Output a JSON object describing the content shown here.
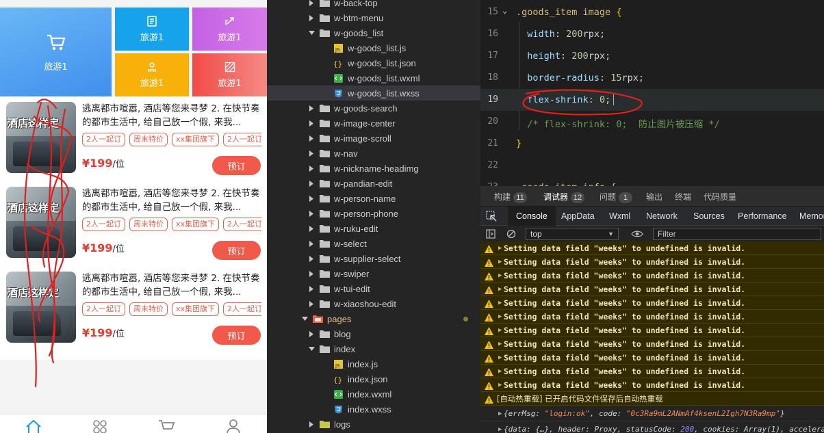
{
  "phone": {
    "tiles": [
      {
        "label": "旅游1",
        "icon": "cart-icon",
        "color": "#3f9df0"
      },
      {
        "label": "旅游1",
        "icon": "list-icon",
        "color": "#16a3ec"
      },
      {
        "label": "旅游1",
        "icon": "share-icon",
        "color": "#c461e6"
      },
      {
        "label": "旅游1",
        "icon": "user-icon",
        "color": "#f7b10a"
      },
      {
        "label": "旅游1",
        "icon": "stripes-icon",
        "color": "#f35f59"
      }
    ],
    "items": [
      {
        "title": "逃离都市喧嚣, 酒店等您来寻梦 2. 在快节奏的都市生活中, 给自己放一个假, 来我...",
        "thumb_text": "酒店这样定",
        "tags": [
          "2人一起订",
          "周末特价",
          "xx集团旗下",
          "2人一起订"
        ],
        "price": "¥199",
        "unit": "/位",
        "button": "预订"
      },
      {
        "title": "逃离都市喧嚣, 酒店等您来寻梦 2. 在快节奏的都市生活中, 给自己放一个假, 来我...",
        "thumb_text": "酒店这样定",
        "tags": [
          "2人一起订",
          "周末特价",
          "xx集团旗下",
          "2人一起订"
        ],
        "price": "¥199",
        "unit": "/位",
        "button": "预订"
      },
      {
        "title": "逃离都市喧嚣, 酒店等您来寻梦 2. 在快节奏的都市生活中, 给自己放一个假, 来我...",
        "thumb_text": "酒店这样定",
        "tags": [
          "2人一起订",
          "周末特价",
          "xx集团旗下",
          "2人一起订"
        ],
        "price": "¥199",
        "unit": "/位",
        "button": "预订"
      }
    ],
    "tabbar": [
      "home-icon",
      "apps-icon",
      "cart-icon",
      "profile-icon"
    ]
  },
  "tree": [
    {
      "name": "w-back-top",
      "type": "folder",
      "level": 1,
      "open": false
    },
    {
      "name": "w-btm-menu",
      "type": "folder",
      "level": 1,
      "open": false
    },
    {
      "name": "w-goods_list",
      "type": "folder",
      "level": 1,
      "open": true
    },
    {
      "name": "w-goods_list.js",
      "type": "js",
      "level": 2
    },
    {
      "name": "w-goods_list.json",
      "type": "json",
      "level": 2
    },
    {
      "name": "w-goods_list.wxml",
      "type": "wxml",
      "level": 2
    },
    {
      "name": "w-goods_list.wxss",
      "type": "wxss",
      "level": 2,
      "selected": true
    },
    {
      "name": "w-goods-search",
      "type": "folder",
      "level": 1,
      "open": false
    },
    {
      "name": "w-image-center",
      "type": "folder",
      "level": 1,
      "open": false
    },
    {
      "name": "w-image-scroll",
      "type": "folder",
      "level": 1,
      "open": false
    },
    {
      "name": "w-nav",
      "type": "folder",
      "level": 1,
      "open": false
    },
    {
      "name": "w-nickname-headimg",
      "type": "folder",
      "level": 1,
      "open": false
    },
    {
      "name": "w-pandian-edit",
      "type": "folder",
      "level": 1,
      "open": false
    },
    {
      "name": "w-person-name",
      "type": "folder",
      "level": 1,
      "open": false
    },
    {
      "name": "w-person-phone",
      "type": "folder",
      "level": 1,
      "open": false
    },
    {
      "name": "w-ruku-edit",
      "type": "folder",
      "level": 1,
      "open": false
    },
    {
      "name": "w-select",
      "type": "folder",
      "level": 1,
      "open": false
    },
    {
      "name": "w-supplier-select",
      "type": "folder",
      "level": 1,
      "open": false
    },
    {
      "name": "w-swiper",
      "type": "folder",
      "level": 1,
      "open": false
    },
    {
      "name": "w-tui-edit",
      "type": "folder",
      "level": 1,
      "open": false
    },
    {
      "name": "w-xiaoshou-edit",
      "type": "folder",
      "level": 1,
      "open": false
    },
    {
      "name": "pages",
      "type": "pages",
      "level": 0,
      "open": true
    },
    {
      "name": "blog",
      "type": "folder",
      "level": 1,
      "open": false
    },
    {
      "name": "index",
      "type": "folder",
      "level": 1,
      "open": true
    },
    {
      "name": "index.js",
      "type": "js",
      "level": 2
    },
    {
      "name": "index.json",
      "type": "json",
      "level": 2
    },
    {
      "name": "index.wxml",
      "type": "wxml",
      "level": 2
    },
    {
      "name": "index.wxss",
      "type": "wxss",
      "level": 2
    },
    {
      "name": "logs",
      "type": "logs",
      "level": 1,
      "open": false
    }
  ],
  "editor": {
    "lines": [
      {
        "num": "15",
        "code": [
          [
            ".goods_item image ",
            "sel"
          ],
          [
            "{",
            "br"
          ]
        ],
        "fold": true
      },
      {
        "num": "16",
        "code": [
          [
            "  width",
            "prop"
          ],
          [
            ": ",
            "unit"
          ],
          [
            "200",
            "num"
          ],
          [
            "rpx;",
            "unit"
          ]
        ]
      },
      {
        "num": "17",
        "code": [
          [
            "  height",
            "prop"
          ],
          [
            ": ",
            "unit"
          ],
          [
            "200",
            "num"
          ],
          [
            "rpx;",
            "unit"
          ]
        ]
      },
      {
        "num": "18",
        "code": [
          [
            "  border-radius",
            "prop"
          ],
          [
            ": ",
            "unit"
          ],
          [
            "15",
            "num"
          ],
          [
            "rpx;",
            "unit"
          ]
        ]
      },
      {
        "num": "19",
        "code": [
          [
            "  flex-shrink",
            "prop"
          ],
          [
            ": ",
            "unit"
          ],
          [
            "0",
            "num"
          ],
          [
            ";",
            "unit"
          ]
        ],
        "current": true
      },
      {
        "num": "20",
        "code": [
          [
            "  /* flex-shrink: 0;  防止图片被压缩 */",
            "cmt"
          ]
        ]
      },
      {
        "num": "21",
        "code": [
          [
            "}",
            "br"
          ]
        ]
      },
      {
        "num": "22",
        "code": []
      },
      {
        "num": "23",
        "code": [
          [
            ".goods_item_info {",
            "sel"
          ]
        ],
        "fold": true
      }
    ]
  },
  "devtools": {
    "top_tabs": [
      {
        "label": "构建",
        "count": "11"
      },
      {
        "label": "调试器",
        "count": "12",
        "active": true
      },
      {
        "label": "问题",
        "count": "1"
      },
      {
        "label": "输出"
      },
      {
        "label": "终端"
      },
      {
        "label": "代码质量"
      }
    ],
    "tabs": [
      "Console",
      "AppData",
      "Wxml",
      "Network",
      "Sources",
      "Performance",
      "Memory"
    ],
    "active_tab": "Console",
    "context": "top",
    "filter_placeholder": "Filter",
    "warning_text": "Setting data field \"weeks\" to undefined is invalid.",
    "warning_count": 11,
    "hot_reload": "[自动热重载] 已开启代码文件保存后自动热重载",
    "log1": {
      "pre": "{errMsg: ",
      "msg": "\"login:ok\"",
      "mid": ", code: ",
      "code": "\"0c3Ra9mL2ANmAf4ksenL2Igh7N3Ra9mp\"",
      "post": "}"
    },
    "log2": {
      "pre": "{data: {…}, header: Proxy, statusCode: ",
      "status": "200",
      "post": ", cookies: Array(1), accelera"
    }
  },
  "colors": {
    "accent_red": "#f15a4a",
    "price_red": "#e63b2e",
    "tag_orange": "#e0664f",
    "annotation_red": "#e02020"
  }
}
